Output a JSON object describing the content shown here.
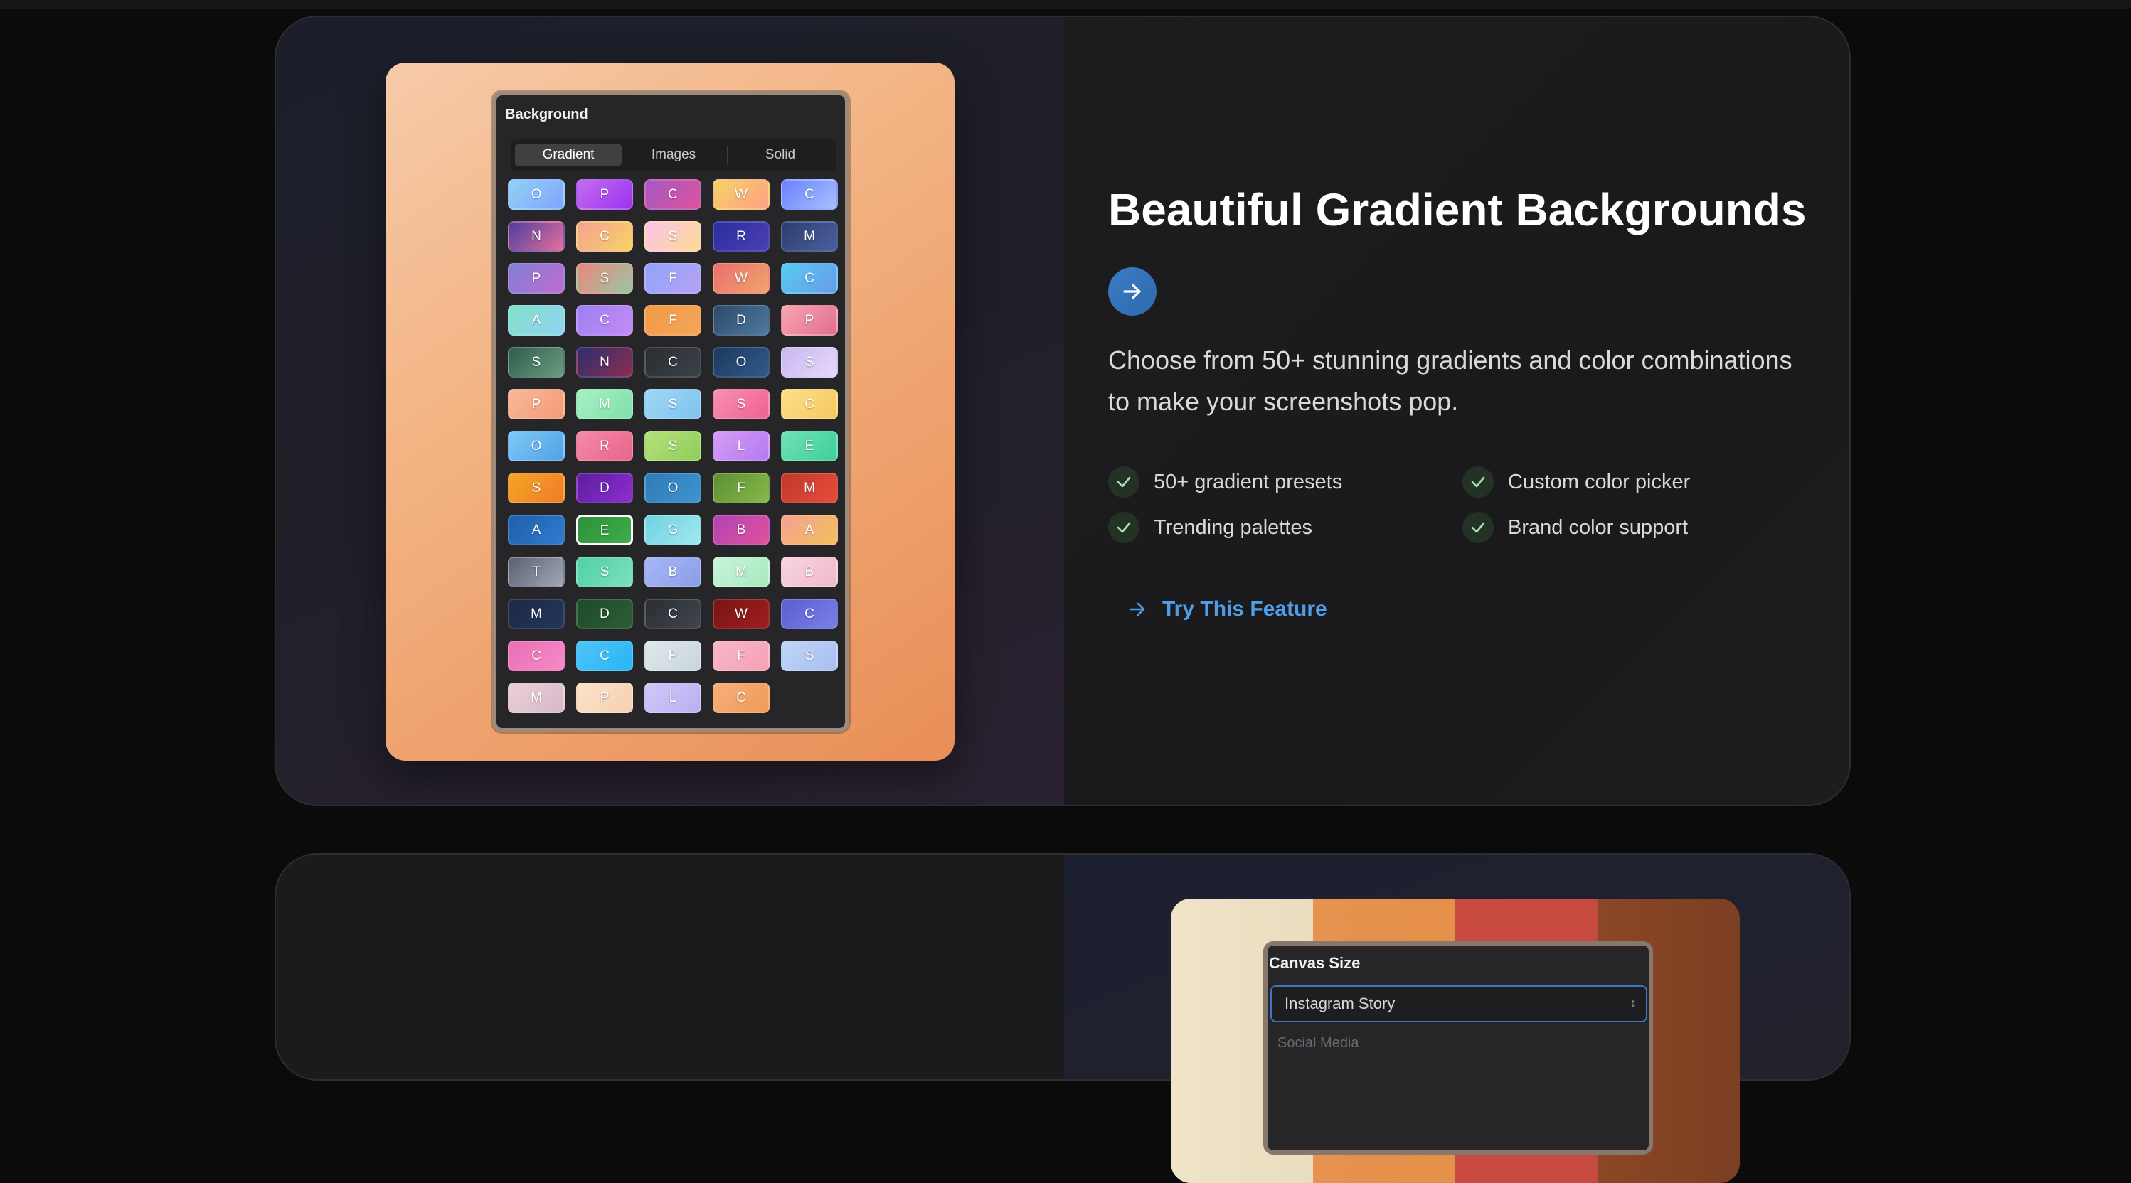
{
  "card1": {
    "panel": {
      "title": "Background",
      "tabs": [
        {
          "label": "Gradient",
          "active": true
        },
        {
          "label": "Images",
          "active": false
        },
        {
          "label": "Solid",
          "active": false
        }
      ],
      "swatches": [
        {
          "letter": "O",
          "bg": "linear-gradient(135deg,#8fd3f4,#84a3ff)"
        },
        {
          "letter": "P",
          "bg": "linear-gradient(135deg,#c56cf0,#9b34ef)"
        },
        {
          "letter": "C",
          "bg": "linear-gradient(135deg,#a259c6,#e0529c)"
        },
        {
          "letter": "W",
          "bg": "linear-gradient(135deg,#f6d365,#fda085)"
        },
        {
          "letter": "C",
          "bg": "linear-gradient(135deg,#6a82fb,#a8c0ff)"
        },
        {
          "letter": "N",
          "bg": "linear-gradient(135deg,#4b3f9e,#e96f9d)"
        },
        {
          "letter": "C",
          "bg": "linear-gradient(135deg,#f6a192,#f6d365)"
        },
        {
          "letter": "S",
          "bg": "linear-gradient(135deg,#fbc2eb,#fddb92)"
        },
        {
          "letter": "R",
          "bg": "linear-gradient(135deg,#2b2d9e,#4b3fb4)"
        },
        {
          "letter": "M",
          "bg": "linear-gradient(135deg,#2c3e70,#4b5f9e)"
        },
        {
          "letter": "P",
          "bg": "linear-gradient(135deg,#7f7fd5,#c06cd0)"
        },
        {
          "letter": "S",
          "bg": "linear-gradient(135deg,#e9877b,#9bc5a3)"
        },
        {
          "letter": "F",
          "bg": "linear-gradient(135deg,#8ea6f8,#b9a0f5)"
        },
        {
          "letter": "W",
          "bg": "linear-gradient(135deg,#e96f6f,#f0a36b)"
        },
        {
          "letter": "C",
          "bg": "linear-gradient(135deg,#56ccf2,#6a9ae8)"
        },
        {
          "letter": "A",
          "bg": "linear-gradient(135deg,#84e0c8,#8fd3f4)"
        },
        {
          "letter": "C",
          "bg": "linear-gradient(135deg,#9b7ff0,#c58cf5)"
        },
        {
          "letter": "F",
          "bg": "linear-gradient(135deg,#f09a45,#f5a55b)"
        },
        {
          "letter": "D",
          "bg": "linear-gradient(135deg,#2f4a6b,#4e7a9e)"
        },
        {
          "letter": "P",
          "bg": "linear-gradient(135deg,#f6a6b2,#e26d8e)"
        },
        {
          "letter": "S",
          "bg": "linear-gradient(135deg,#2f5d50,#6b9e7e)"
        },
        {
          "letter": "N",
          "bg": "linear-gradient(135deg,#2c2f70,#8b2d4f)"
        },
        {
          "letter": "C",
          "bg": "linear-gradient(135deg,#2a2e33,#3b4248)"
        },
        {
          "letter": "O",
          "bg": "linear-gradient(135deg,#1e3a5f,#2f5a8a)"
        },
        {
          "letter": "S",
          "bg": "linear-gradient(135deg,#c8b8f0,#e6d9fb)"
        },
        {
          "letter": "P",
          "bg": "linear-gradient(135deg,#f8b99a,#f49a76)"
        },
        {
          "letter": "M",
          "bg": "linear-gradient(135deg,#a8f0c5,#7fe0a8)"
        },
        {
          "letter": "S",
          "bg": "linear-gradient(135deg,#a0d8f5,#7ec3f0)"
        },
        {
          "letter": "S",
          "bg": "linear-gradient(135deg,#f78fb3,#f06292)"
        },
        {
          "letter": "C",
          "bg": "linear-gradient(135deg,#fbe08a,#f6c85f)"
        },
        {
          "letter": "O",
          "bg": "linear-gradient(135deg,#7fc8f8,#4fa3e8)"
        },
        {
          "letter": "R",
          "bg": "linear-gradient(135deg,#f58aa8,#e8658a)"
        },
        {
          "letter": "S",
          "bg": "linear-gradient(135deg,#b6e07a,#8fce5a)"
        },
        {
          "letter": "L",
          "bg": "linear-gradient(135deg,#d59cf7,#b57af0)"
        },
        {
          "letter": "E",
          "bg": "linear-gradient(135deg,#6ee2b5,#3fcf9a)"
        },
        {
          "letter": "S",
          "bg": "linear-gradient(135deg,#f5a623,#f07a2a)"
        },
        {
          "letter": "D",
          "bg": "linear-gradient(135deg,#5b1f9e,#8e2dd0)"
        },
        {
          "letter": "O",
          "bg": "linear-gradient(135deg,#2f7ab8,#3e95d0)"
        },
        {
          "letter": "F",
          "bg": "linear-gradient(135deg,#5e8f34,#86b84a)"
        },
        {
          "letter": "M",
          "bg": "linear-gradient(135deg,#c0392b,#e74c3c)"
        },
        {
          "letter": "A",
          "bg": "linear-gradient(135deg,#1f5fa8,#2f7bd0)"
        },
        {
          "letter": "E",
          "bg": "linear-gradient(135deg,#2f8f3a,#3fae4a)"
        },
        {
          "letter": "G",
          "bg": "linear-gradient(135deg,#6fd3e0,#a0e8f0)"
        },
        {
          "letter": "B",
          "bg": "linear-gradient(135deg,#b043b5,#e0529c)"
        },
        {
          "letter": "A",
          "bg": "linear-gradient(135deg,#f6a192,#f0c05b)"
        },
        {
          "letter": "T",
          "bg": "linear-gradient(135deg,#5a6072,#a3a8b8)"
        },
        {
          "letter": "S",
          "bg": "linear-gradient(135deg,#4fd0a5,#7ee0c0)"
        },
        {
          "letter": "B",
          "bg": "linear-gradient(135deg,#a8b8f5,#8a9de8)"
        },
        {
          "letter": "M",
          "bg": "linear-gradient(135deg,#c7f5d8,#a8e8c0)"
        },
        {
          "letter": "B",
          "bg": "linear-gradient(135deg,#f8d5e0,#f0b8cc)"
        },
        {
          "letter": "M",
          "bg": "linear-gradient(135deg,#1c2a44,#24365a)"
        },
        {
          "letter": "D",
          "bg": "linear-gradient(135deg,#1f4a2a,#2a5e36)"
        },
        {
          "letter": "C",
          "bg": "linear-gradient(135deg,#2a2e33,#40464d)"
        },
        {
          "letter": "W",
          "bg": "linear-gradient(135deg,#7a1414,#9e1f1f)"
        },
        {
          "letter": "C",
          "bg": "linear-gradient(135deg,#5a5fd0,#7a7fe8)"
        },
        {
          "letter": "C",
          "bg": "linear-gradient(135deg,#e96fb5,#f58ac8)"
        },
        {
          "letter": "C",
          "bg": "linear-gradient(135deg,#4fc3f7,#29b6f6)"
        },
        {
          "letter": "P",
          "bg": "linear-gradient(135deg,#dfe8ec,#c8d6dc)"
        },
        {
          "letter": "F",
          "bg": "linear-gradient(135deg,#f8b8c8,#f5a0b5)"
        },
        {
          "letter": "S",
          "bg": "linear-gradient(135deg,#c0d4f8,#a8c0f0)"
        },
        {
          "letter": "M",
          "bg": "linear-gradient(135deg,#e8d0d8,#d8b8c8)"
        },
        {
          "letter": "P",
          "bg": "linear-gradient(135deg,#fbe3cc,#f6d0b0)"
        },
        {
          "letter": "L",
          "bg": "linear-gradient(135deg,#d0c8f8,#b8b0f0)"
        },
        {
          "letter": "C",
          "bg": "linear-gradient(135deg,#f6b07a,#f09a5a)"
        }
      ],
      "selected_index": 41
    },
    "title": "Beautiful Gradient Backgrounds",
    "description": "Choose from 50+ stunning gradients and color combinations to make your screenshots pop.",
    "features": [
      "50+ gradient presets",
      "Custom color picker",
      "Trending palettes",
      "Brand color support"
    ],
    "cta": "Try This Feature",
    "colors": {
      "accent": "#4f9ee8",
      "circle": "#3b7cc4",
      "check_bg": "#243226"
    }
  },
  "card2": {
    "panel_title": "Canvas Size",
    "select_value": "Instagram Story",
    "hint": "Social Media"
  }
}
